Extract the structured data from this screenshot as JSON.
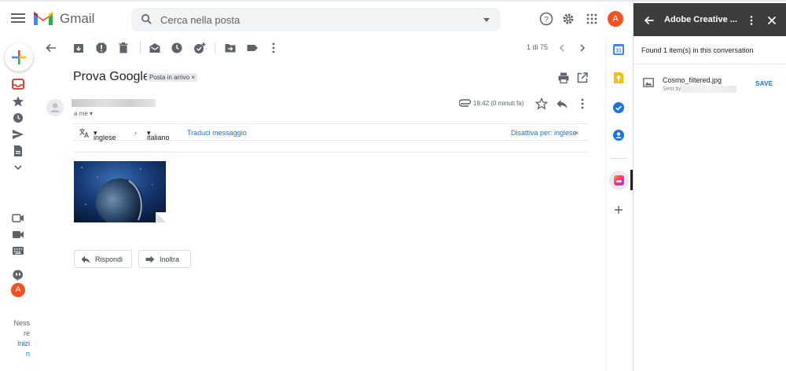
{
  "app": {
    "name": "Gmail",
    "search_placeholder": "Cerca nella posta",
    "avatar_letter": "A",
    "accent_color": "#1a73e8",
    "avatar_color": "#f4511e"
  },
  "left_rail": {
    "icons": [
      "compose-icon",
      "inbox-icon",
      "star-icon",
      "clock-icon",
      "send-icon",
      "file-icon",
      "chevron-down-icon",
      "meet-new-icon",
      "video-icon",
      "keyboard-icon",
      "hangouts-icon"
    ],
    "hangouts_avatar": "A",
    "hangouts_text": [
      "Ness",
      "re"
    ],
    "hangouts_link": [
      "Inizi",
      "n"
    ]
  },
  "toolbar": {
    "icons": [
      "back-arrow-icon",
      "archive-icon",
      "report-spam-icon",
      "delete-icon",
      "mark-unread-icon",
      "snooze-icon",
      "add-task-icon",
      "move-to-icon",
      "label-icon",
      "more-vert-icon"
    ],
    "page_counter": "1 di 75"
  },
  "message": {
    "subject": "Prova Google",
    "label": "Posta in arrivo ×",
    "to": "a me",
    "time": "18:42 (0 minuti fa)",
    "translation": {
      "from_lang": "inglese",
      "to_lang": "italiano",
      "translate_link": "Traduci messaggio",
      "disable_link": "Disattiva per: inglese",
      "close": "×"
    },
    "reply_button": "Rispondi",
    "forward_button": "Inoltra"
  },
  "addon_rail": {
    "icons": [
      "calendar-icon",
      "keep-icon",
      "tasks-icon",
      "contacts-icon",
      "creative-cloud-icon",
      "add-icon"
    ]
  },
  "panel": {
    "title": "Adobe Creative ...",
    "found_text": "Found 1 item(s) in this conversation",
    "file_name": "Cosmo_filtered.jpg",
    "sent_by": "Sent by",
    "save_label": "SAVE"
  }
}
